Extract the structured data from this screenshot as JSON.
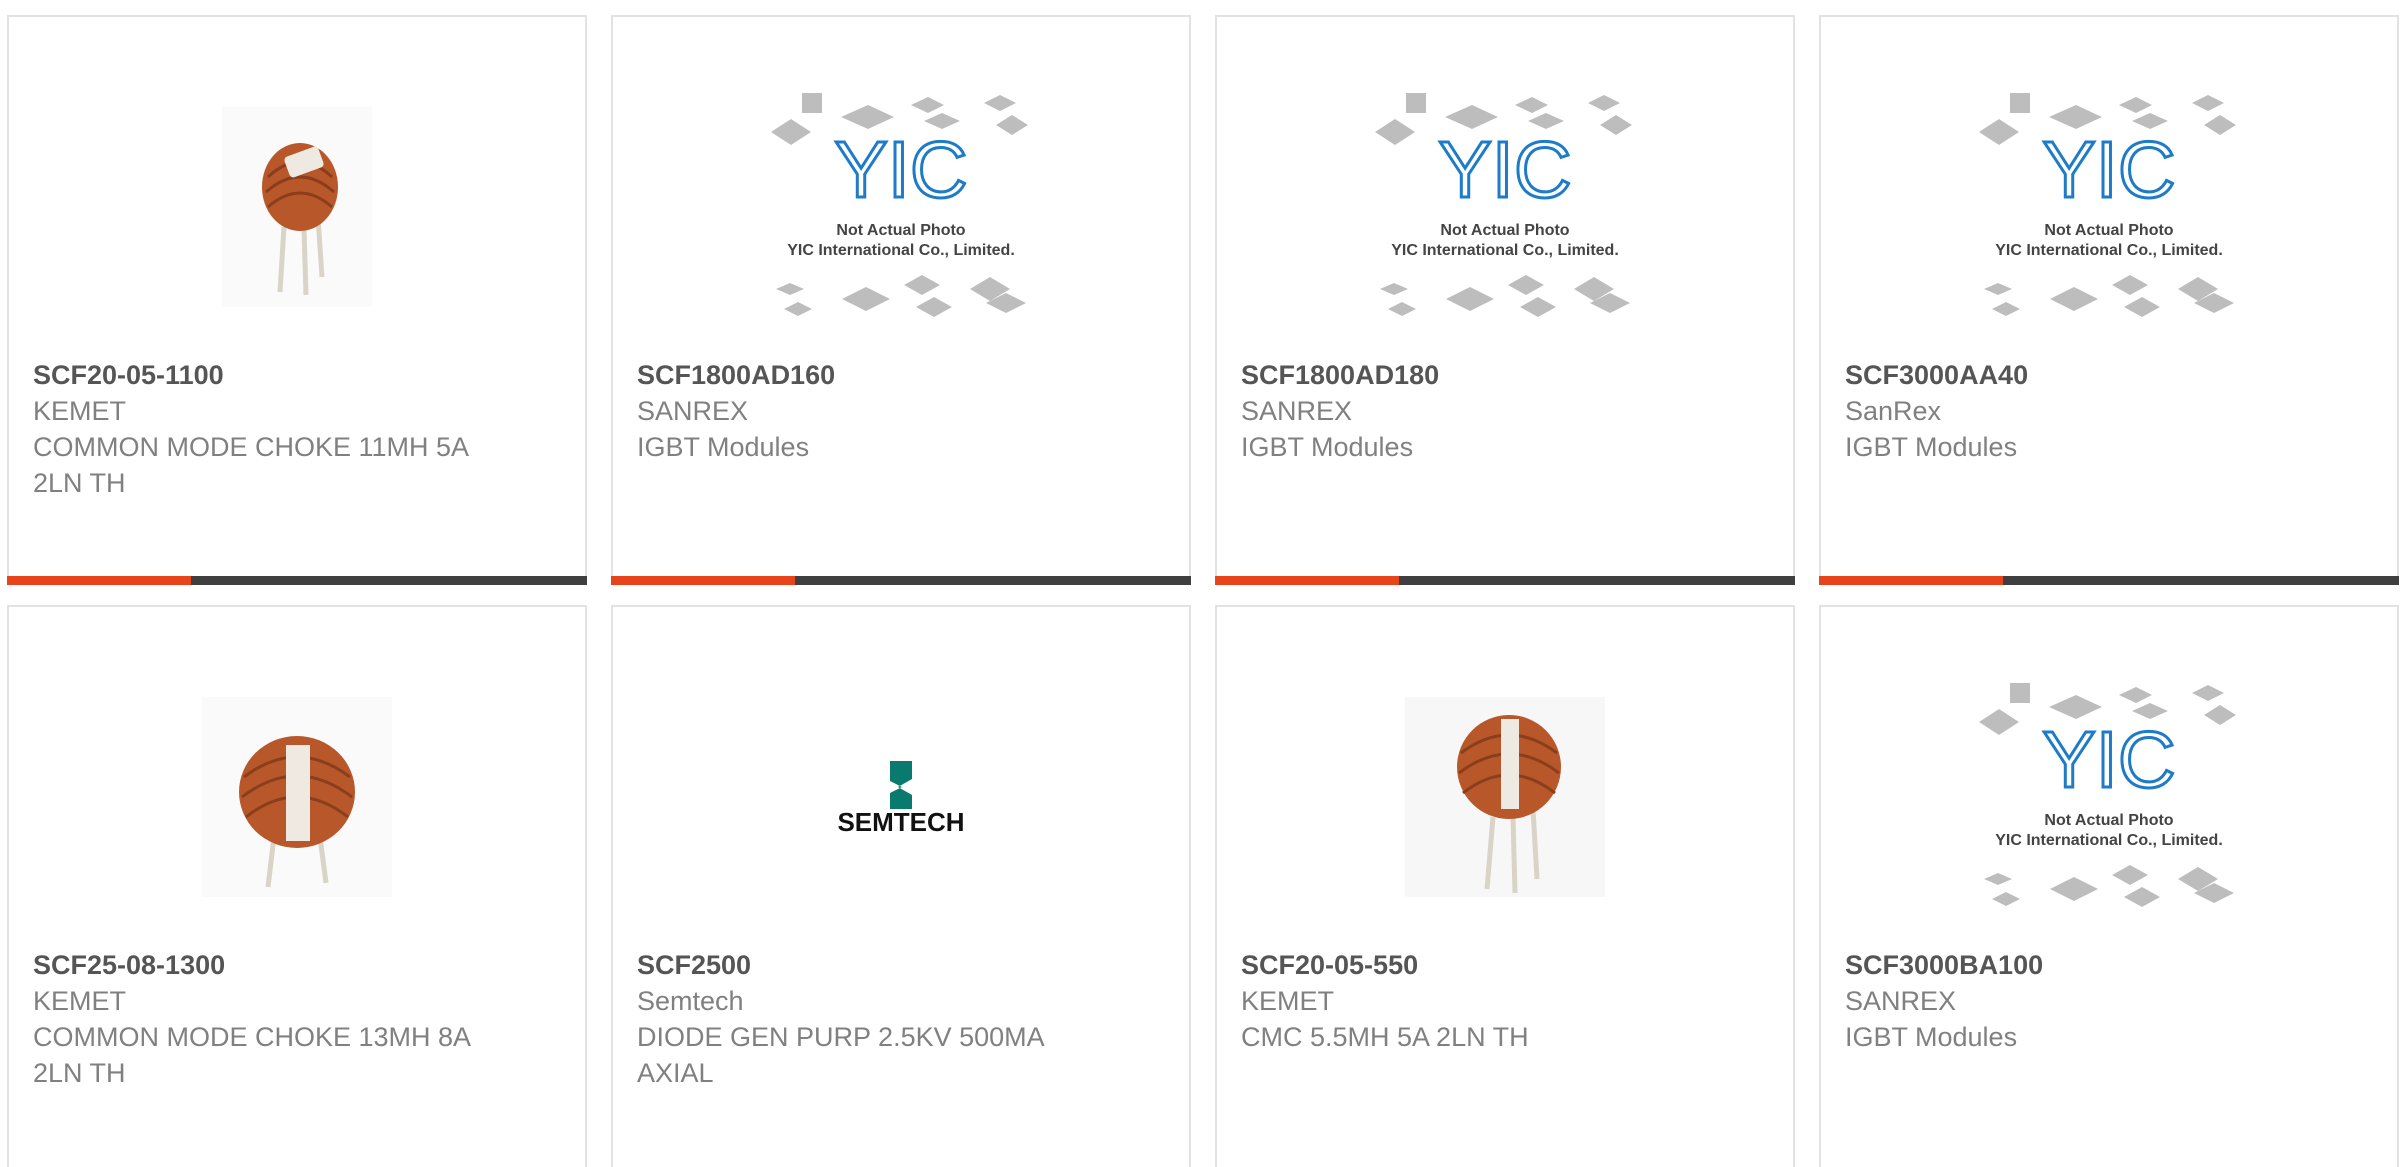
{
  "placeholder": {
    "line1": "Not Actual Photo",
    "line2": "YIC International Co., Limited.",
    "logo_text": "YIC"
  },
  "brand_logo_text": "SEMTECH",
  "colors": {
    "accent": "#e8441b",
    "bar": "#3f3f3f",
    "part_text": "#555555",
    "meta_text": "#808080",
    "card_border": "#e2e2e2",
    "copper": "#b8582a",
    "yic_blue": "#1e7bc8",
    "semtech_green": "#0b7a6e"
  },
  "products": [
    {
      "part": "SCF20-05-1100",
      "maker": "KEMET",
      "desc": "COMMON MODE CHOKE 11MH 5A 2LN TH",
      "image": "choke-photo"
    },
    {
      "part": "SCF1800AD160",
      "maker": "SANREX",
      "desc": "IGBT Modules",
      "image": "placeholder"
    },
    {
      "part": "SCF1800AD180",
      "maker": "SANREX",
      "desc": "IGBT Modules",
      "image": "placeholder"
    },
    {
      "part": "SCF3000AA40",
      "maker": "SanRex",
      "desc": "IGBT Modules",
      "image": "placeholder"
    },
    {
      "part": "SCF25-08-1300",
      "maker": "KEMET",
      "desc": "COMMON MODE CHOKE 13MH 8A 2LN TH",
      "image": "choke-photo"
    },
    {
      "part": "SCF2500",
      "maker": "Semtech",
      "desc": "DIODE GEN PURP 2.5KV 500MA AXIAL",
      "image": "brand-logo"
    },
    {
      "part": "SCF20-05-550",
      "maker": "KEMET",
      "desc": "CMC 5.5MH 5A 2LN TH",
      "image": "choke-photo"
    },
    {
      "part": "SCF3000BA100",
      "maker": "SANREX",
      "desc": "IGBT Modules",
      "image": "placeholder"
    }
  ]
}
